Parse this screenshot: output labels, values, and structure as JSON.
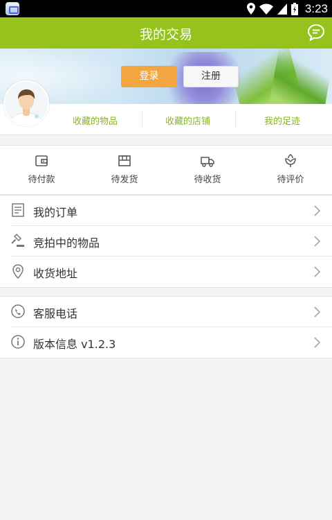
{
  "status_bar": {
    "time": "3:23"
  },
  "header": {
    "title": "我的交易"
  },
  "auth": {
    "login_label": "登录",
    "register_label": "注册"
  },
  "favorites": [
    {
      "label": "收藏的物品"
    },
    {
      "label": "收藏的店铺"
    },
    {
      "label": "我的足迹"
    }
  ],
  "order_status": [
    {
      "label": "待付款",
      "icon": "wallet-icon"
    },
    {
      "label": "待发货",
      "icon": "box-icon"
    },
    {
      "label": "待收货",
      "icon": "truck-icon"
    },
    {
      "label": "待评价",
      "icon": "flower-icon"
    }
  ],
  "menu_primary": [
    {
      "label": "我的订单",
      "icon": "order-list-icon"
    },
    {
      "label": "竞拍中的物品",
      "icon": "gavel-icon"
    },
    {
      "label": "收货地址",
      "icon": "location-pin-icon"
    }
  ],
  "menu_secondary": [
    {
      "label": "客服电话",
      "icon": "phone-icon"
    },
    {
      "label": "版本信息 v1.2.3",
      "icon": "info-icon"
    }
  ],
  "colors": {
    "brand_green": "#95c31b",
    "accent_orange": "#f3a63f",
    "link_green": "#8ab32a"
  }
}
